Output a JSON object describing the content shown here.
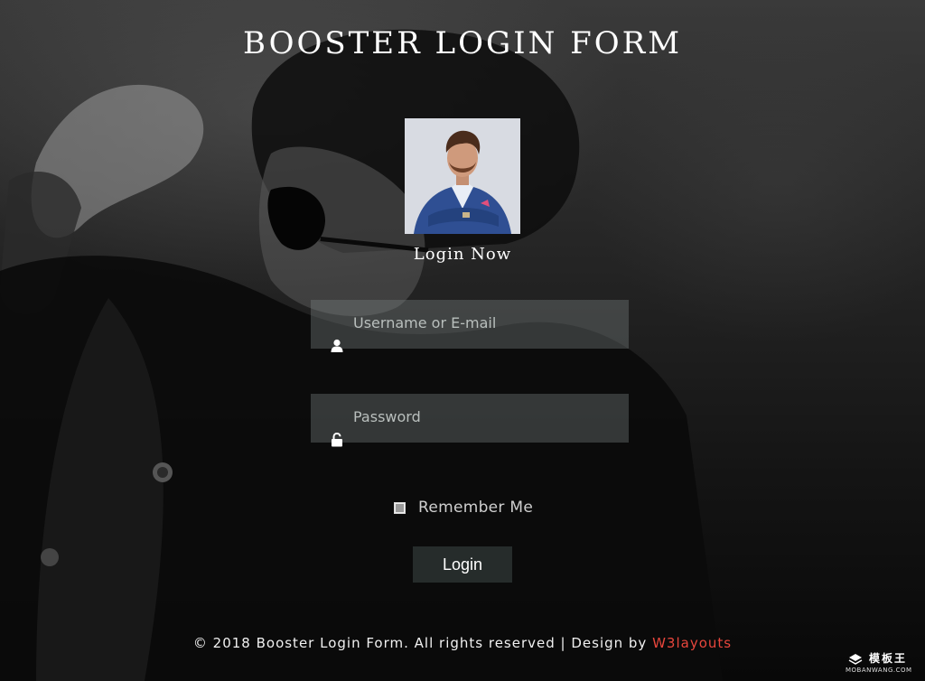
{
  "page": {
    "title": "BOOSTER LOGIN FORM",
    "subtitle": "Login Now"
  },
  "form": {
    "username": {
      "placeholder": "Username or E-mail",
      "value": "",
      "icon": "user-icon"
    },
    "password": {
      "placeholder": "Password",
      "value": "",
      "icon": "unlock-icon"
    },
    "remember": {
      "label": "Remember Me",
      "checked": false
    },
    "submit_label": "Login"
  },
  "footer": {
    "text": "© 2018 Booster Login Form. All rights reserved | Design by",
    "link_text": "W3layouts"
  },
  "watermark": {
    "cn": "模板王",
    "en": "MOBANWANG.COM"
  },
  "colors": {
    "accent_link": "#e8463c",
    "field_bg": "rgba(120,130,128,0.38)",
    "button_bg": "#262c2b"
  }
}
